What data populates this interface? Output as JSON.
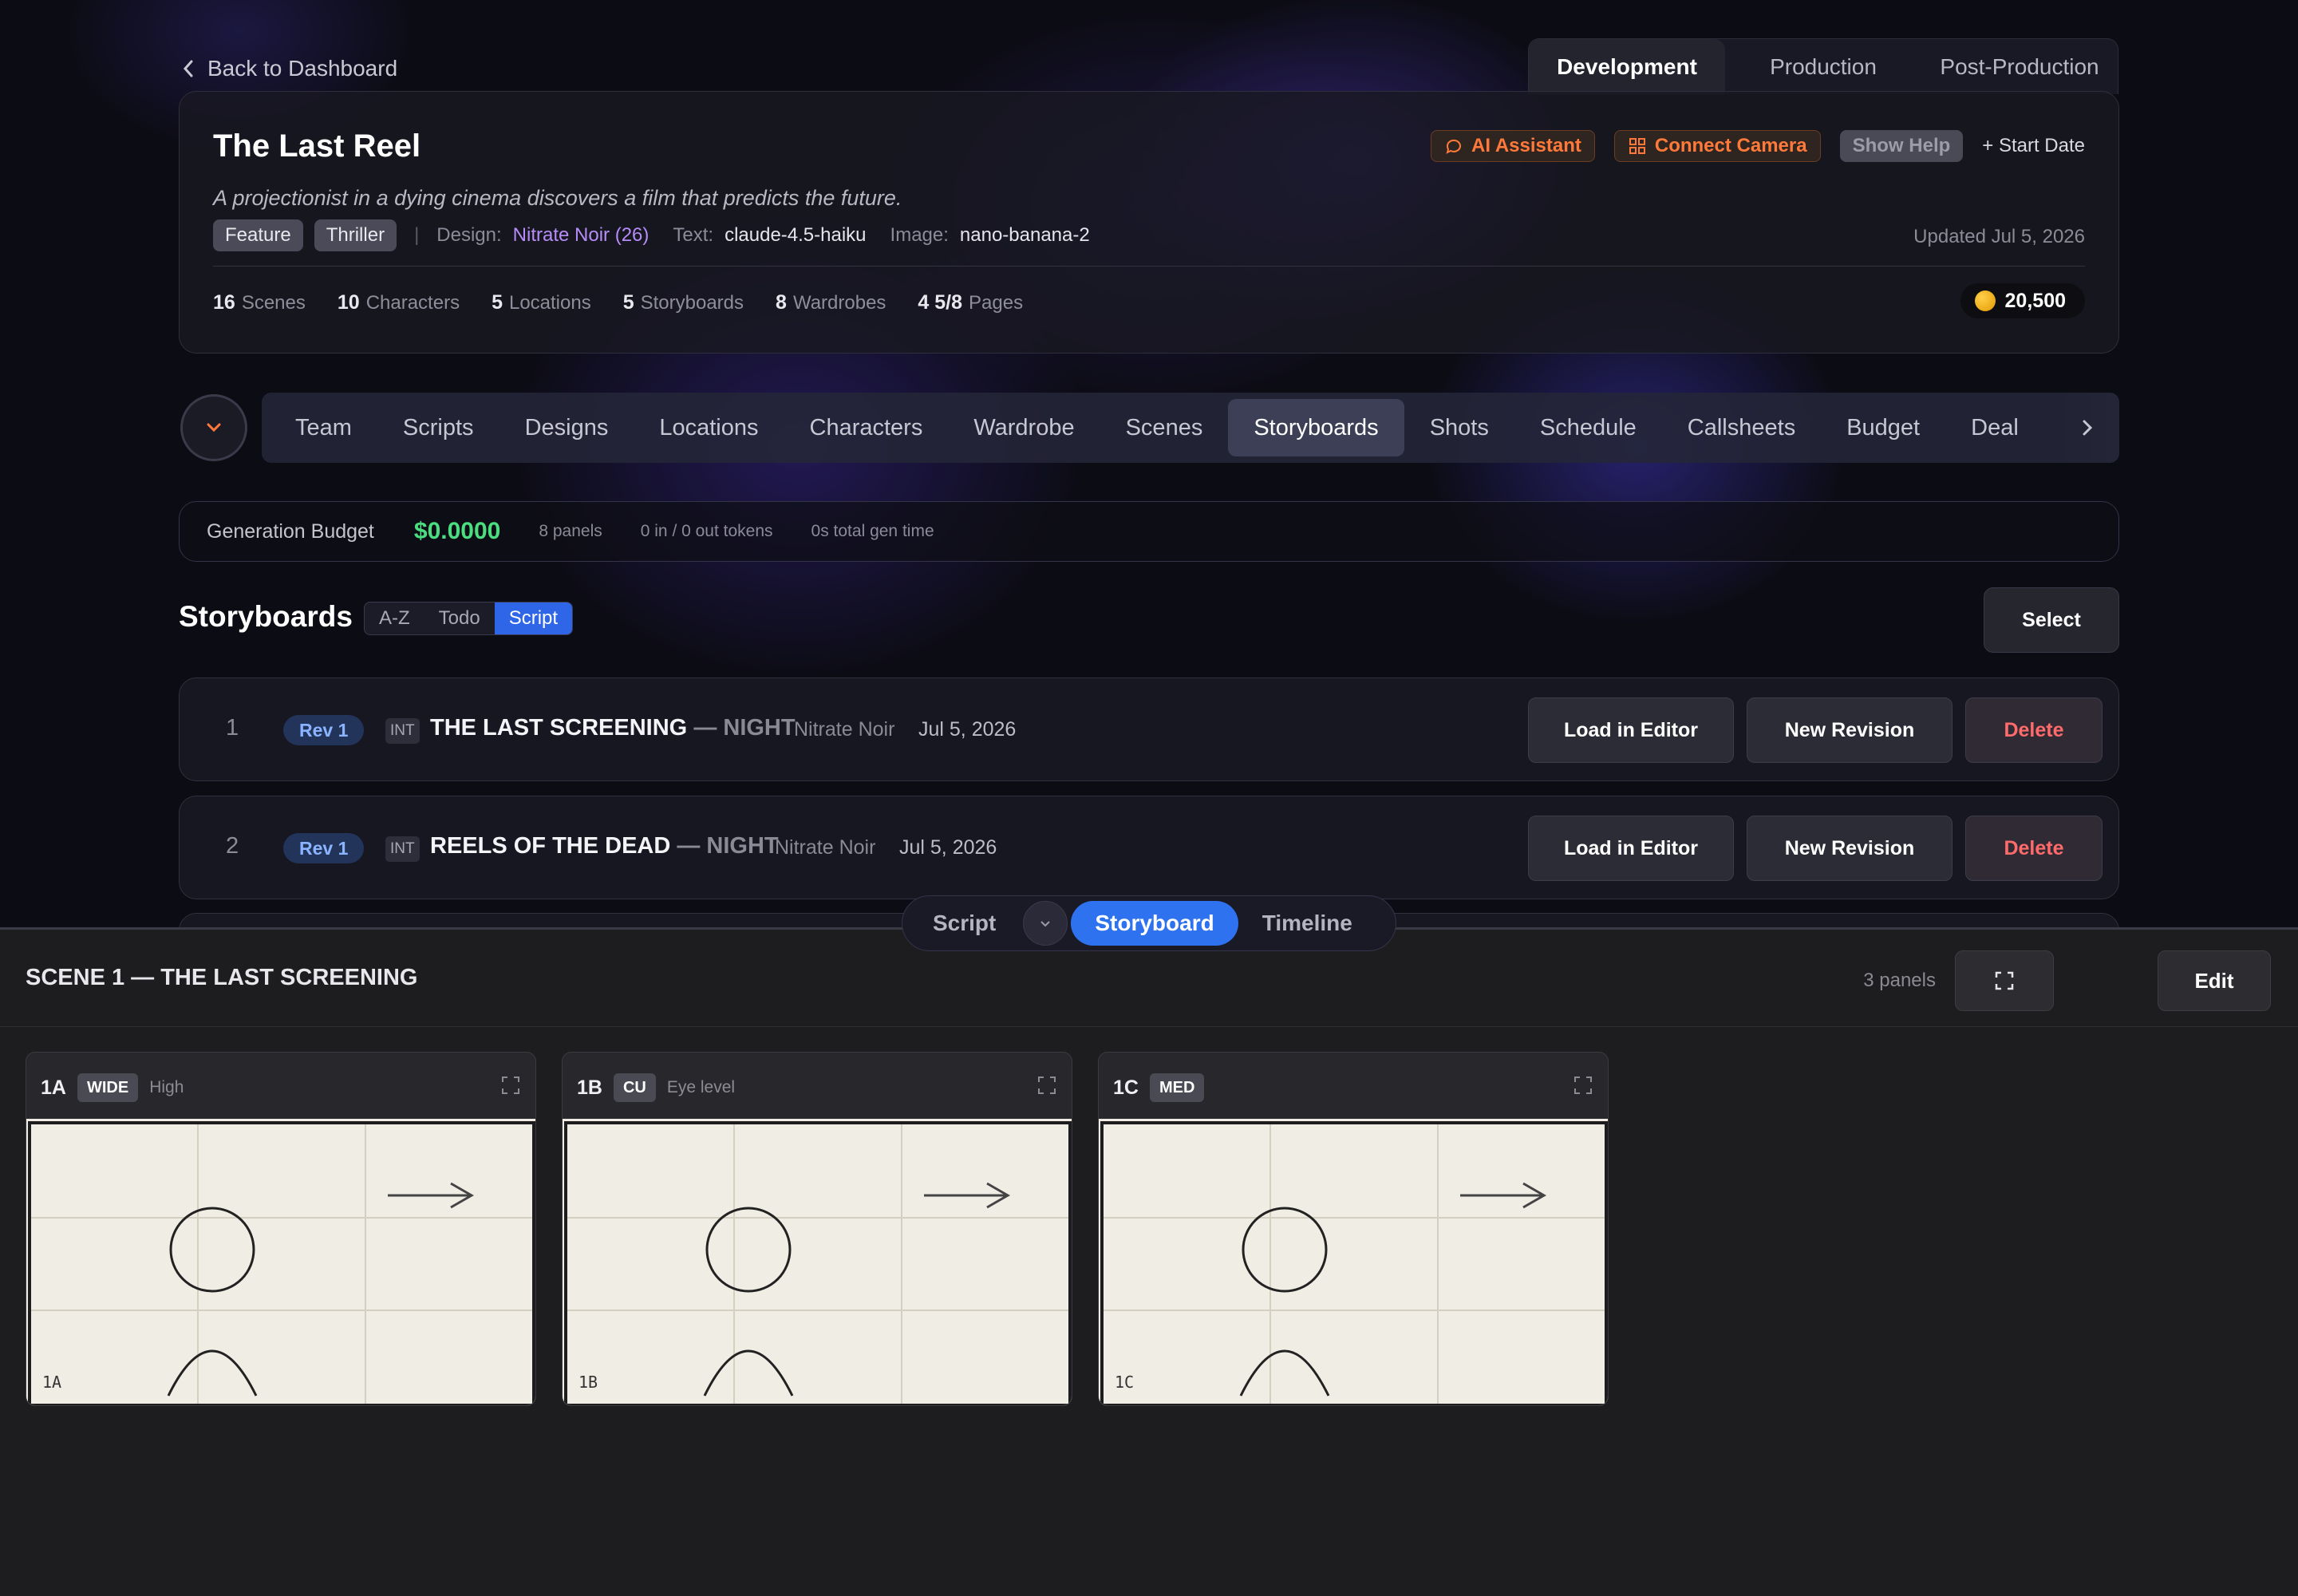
{
  "nav_back": "Back to Dashboard",
  "phases": [
    "Development",
    "Production",
    "Post-Production"
  ],
  "project": {
    "title": "The Last Reel",
    "logline": "A projectionist in a dying cinema discovers a film that predicts the future.",
    "tags": [
      "Feature",
      "Thriller"
    ],
    "design_label": "Design:",
    "design_value": "Nitrate Noir (26)",
    "text_label": "Text:",
    "text_value": "claude-4.5-haiku",
    "image_label": "Image:",
    "image_value": "nano-banana-2",
    "updated": "Updated Jul 5, 2026",
    "actions": {
      "ai": "AI Assistant",
      "camera": "Connect Camera",
      "help": "Show Help",
      "start": "+ Start Date"
    },
    "stats": [
      {
        "n": "16",
        "label": "Scenes"
      },
      {
        "n": "10",
        "label": "Characters"
      },
      {
        "n": "5",
        "label": "Locations"
      },
      {
        "n": "5",
        "label": "Storyboards"
      },
      {
        "n": "8",
        "label": "Wardrobes"
      },
      {
        "n": "4 5/8",
        "label": "Pages"
      }
    ],
    "coins": "20,500"
  },
  "tabs": [
    "Team",
    "Scripts",
    "Designs",
    "Locations",
    "Characters",
    "Wardrobe",
    "Scenes",
    "Storyboards",
    "Shots",
    "Schedule",
    "Callsheets",
    "Budget",
    "Deal"
  ],
  "active_tab": "Storyboards",
  "budget": {
    "label": "Generation Budget",
    "amount": "$0.0000",
    "panels": "8 panels",
    "tokens": "0 in / 0 out tokens",
    "time": "0s total gen time"
  },
  "storyboards": {
    "title": "Storyboards",
    "sorts": [
      "A-Z",
      "Todo",
      "Script"
    ],
    "active_sort": "Script",
    "select_label": "Select",
    "rows": [
      {
        "num": "1",
        "rev": "Rev 1",
        "int": "INT",
        "scene": "THE LAST SCREENING",
        "tod": "— NIGHT",
        "design": "Nitrate Noir",
        "date": "Jul 5, 2026"
      },
      {
        "num": "2",
        "rev": "Rev 1",
        "int": "INT",
        "scene": "REELS OF THE DEAD",
        "tod": "— NIGHT",
        "design": "Nitrate Noir",
        "date": "Jul 5, 2026"
      }
    ],
    "row_actions": {
      "load": "Load in Editor",
      "revision": "New Revision",
      "delete": "Delete"
    }
  },
  "view_toggle": {
    "script": "Script",
    "storyboard": "Storyboard",
    "timeline": "Timeline"
  },
  "scene_panel": {
    "title": "SCENE 1 — THE LAST SCREENING",
    "count": "3 panels",
    "edit": "Edit",
    "panels": [
      {
        "id": "1A",
        "shot": "WIDE",
        "angle": "High",
        "caption": "1A"
      },
      {
        "id": "1B",
        "shot": "CU",
        "angle": "Eye level",
        "caption": "1B"
      },
      {
        "id": "1C",
        "shot": "MED",
        "angle": "",
        "caption": "1C"
      }
    ]
  }
}
